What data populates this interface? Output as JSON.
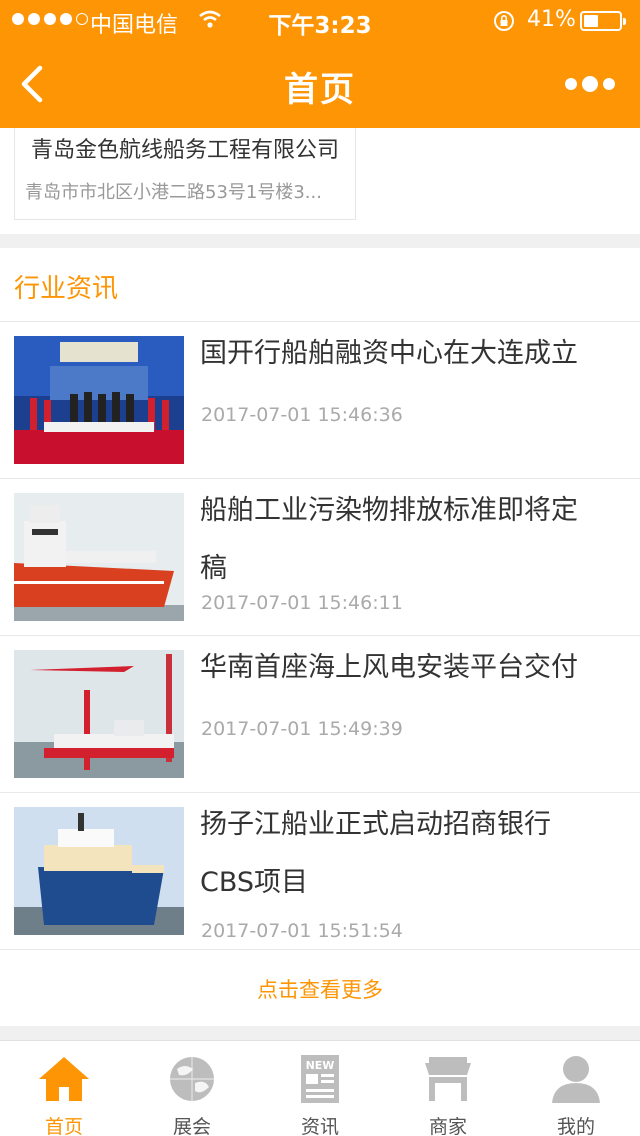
{
  "status_bar": {
    "carrier": "中国电信",
    "time": "下午3:23",
    "battery_percent": "41%",
    "battery_level": 0.41
  },
  "header": {
    "title": "首页",
    "back_icon": "chevron-left-icon",
    "more_icon": "more-dots-icon"
  },
  "company": {
    "name": "青岛金色航线船务工程有限公司",
    "address": "青岛市市北区小港二路53号1号楼3..."
  },
  "news": {
    "section_title": "行业资讯",
    "items": [
      {
        "title": "国开行船舶融资中心在大连成立",
        "date": "2017-07-01 15:46:36"
      },
      {
        "title": "船舶工业污染物排放标准即将定稿",
        "date": "2017-07-01 15:46:11"
      },
      {
        "title": "华南首座海上风电安装平台交付",
        "date": "2017-07-01 15:49:39"
      },
      {
        "title": "扬子江船业正式启动招商银行CBS项目",
        "date": "2017-07-01 15:51:54"
      }
    ],
    "see_more": "点击查看更多"
  },
  "tabbar": {
    "items": [
      {
        "label": "首页",
        "icon": "home-icon",
        "active": true
      },
      {
        "label": "展会",
        "icon": "globe-icon",
        "active": false
      },
      {
        "label": "资讯",
        "icon": "news-icon",
        "active": false
      },
      {
        "label": "商家",
        "icon": "store-icon",
        "active": false
      },
      {
        "label": "我的",
        "icon": "user-icon",
        "active": false
      }
    ]
  },
  "colors": {
    "accent": "#fd9505",
    "tab_inactive": "#bdbdbd"
  }
}
